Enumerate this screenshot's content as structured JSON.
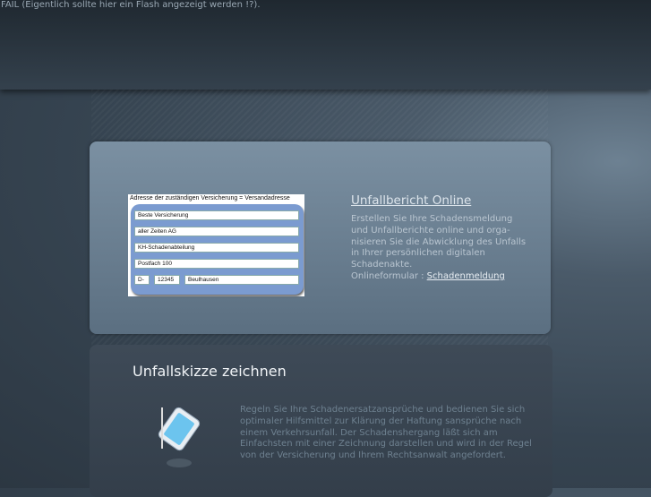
{
  "fail_message": "FAIL (Eigentlich sollte hier ein Flash angezeigt werden !?).",
  "form_preview": {
    "caption": "Adresse der zuständigen Versicherung = Versandadresse",
    "lines": [
      "Beste Versicherung",
      "aller Zeiten AG",
      "KH-Schadenabteilung",
      "Postfach 100"
    ],
    "country": "D-",
    "zip": "12345",
    "city": "Beulhausen"
  },
  "section1": {
    "title": "Unfallbericht Online",
    "description": "Erstellen Sie Ihre Schadensmeldung und Unfallberichte online und orga-nisieren Sie die Abwicklung des Unfalls in Ihrer persönlichen digitalen Schadenakte.",
    "form_label": "Onlineformular :",
    "form_link": "Schadenmeldung"
  },
  "section2": {
    "title": "Unfallskizze zeichnen",
    "description": "Regeln Sie Ihre Schadenersatzansprüche und bedienen Sie sich optimaler Hilfsmittel zur Klärung der Haftung sansprüche nach einem Verkehrsunfall. Der Schadenshergang läßt sich am Einfachsten mit einer Zeichnung darstellen und wird in der Regel von der Versicherung und Ihrem Rechtsanwalt angefordert."
  }
}
